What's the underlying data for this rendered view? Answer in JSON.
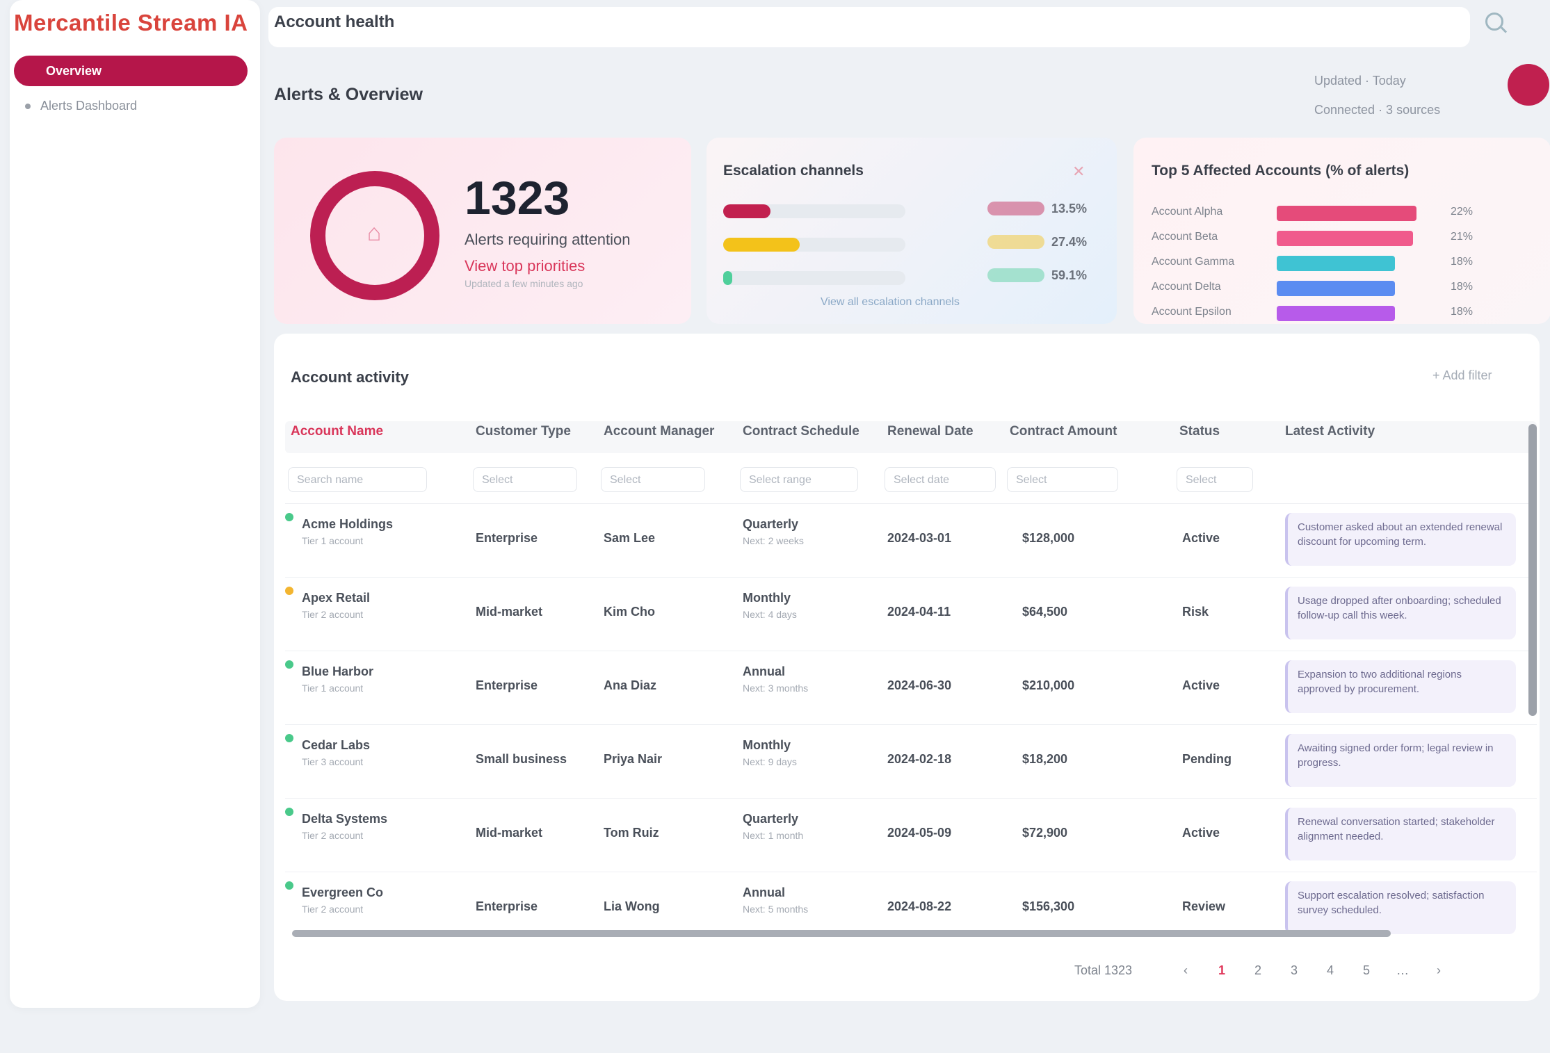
{
  "sidebar": {
    "brand": "Mercantile Stream IA",
    "active_item": "Overview",
    "items": [
      "Alerts Dashboard"
    ]
  },
  "topbar": {
    "breadcrumb": "Account health"
  },
  "header": {
    "title": "Alerts & Overview",
    "meta_line1": "Updated · Today",
    "meta_line2": "Connected · 3 sources"
  },
  "card1": {
    "total": "1323",
    "subtitle": "Alerts requiring attention",
    "link": "View top priorities",
    "note": "Updated a few minutes ago"
  },
  "card2": {
    "title": "Escalation channels",
    "rows": [
      {
        "pct": 0.26,
        "color": "#c2204f",
        "value": "13.5%"
      },
      {
        "pct": 0.42,
        "color": "#f3c21a",
        "value": "27.4%"
      },
      {
        "pct": 0.05,
        "color": "#4fcf9b",
        "value": "59.1%"
      }
    ],
    "footer": "View all escalation channels"
  },
  "card3": {
    "title": "Top 5 Affected Accounts (% of alerts)",
    "rows": [
      {
        "label": "Account Alpha",
        "pct": 0.92,
        "color": "#e54b7a",
        "value": "22%"
      },
      {
        "label": "Account Beta",
        "pct": 0.9,
        "color": "#f05a8c",
        "value": "21%"
      },
      {
        "label": "Account Gamma",
        "pct": 0.78,
        "color": "#3fc3d3",
        "value": "18%"
      },
      {
        "label": "Account Delta",
        "pct": 0.78,
        "color": "#5b8cf1",
        "value": "18%"
      },
      {
        "label": "Account Epsilon",
        "pct": 0.78,
        "color": "#b75bea",
        "value": "18%"
      }
    ]
  },
  "table": {
    "title": "Account activity",
    "action": "+ Add filter",
    "columns": [
      "Account Name",
      "Customer Type",
      "Account Manager",
      "Contract Schedule",
      "Renewal Date",
      "Contract Amount",
      "Status",
      "Latest Activity"
    ],
    "filters": [
      "Search name",
      "Select",
      "Select",
      "Select range",
      "Select date",
      "Select",
      "Select",
      ""
    ],
    "rows": [
      {
        "prio": "#49c98a",
        "name": "Acme Holdings",
        "name_sub": "Tier 1 account",
        "type": "Enterprise",
        "manager": "Sam Lee",
        "schedule": "Quarterly",
        "schedule_sub": "Next: 2 weeks",
        "renewal": "2024-03-01",
        "amount": "$128,000",
        "status": "Active",
        "note": "Customer asked about an extended renewal discount for upcoming term."
      },
      {
        "prio": "#f3b530",
        "name": "Apex Retail",
        "name_sub": "Tier 2 account",
        "type": "Mid-market",
        "manager": "Kim Cho",
        "schedule": "Monthly",
        "schedule_sub": "Next: 4 days",
        "renewal": "2024-04-11",
        "amount": "$64,500",
        "status": "Risk",
        "note": "Usage dropped after onboarding; scheduled follow-up call this week."
      },
      {
        "prio": "#49c98a",
        "name": "Blue Harbor",
        "name_sub": "Tier 1 account",
        "type": "Enterprise",
        "manager": "Ana Diaz",
        "schedule": "Annual",
        "schedule_sub": "Next: 3 months",
        "renewal": "2024-06-30",
        "amount": "$210,000",
        "status": "Active",
        "note": "Expansion to two additional regions approved by procurement."
      },
      {
        "prio": "#49c98a",
        "name": "Cedar Labs",
        "name_sub": "Tier 3 account",
        "type": "Small business",
        "manager": "Priya Nair",
        "schedule": "Monthly",
        "schedule_sub": "Next: 9 days",
        "renewal": "2024-02-18",
        "amount": "$18,200",
        "status": "Pending",
        "note": "Awaiting signed order form; legal review in progress."
      },
      {
        "prio": "#49c98a",
        "name": "Delta Systems",
        "name_sub": "Tier 2 account",
        "type": "Mid-market",
        "manager": "Tom Ruiz",
        "schedule": "Quarterly",
        "schedule_sub": "Next: 1 month",
        "renewal": "2024-05-09",
        "amount": "$72,900",
        "status": "Active",
        "note": "Renewal conversation started; stakeholder alignment needed."
      },
      {
        "prio": "#49c98a",
        "name": "Evergreen Co",
        "name_sub": "Tier 2 account",
        "type": "Enterprise",
        "manager": "Lia Wong",
        "schedule": "Annual",
        "schedule_sub": "Next: 5 months",
        "renewal": "2024-08-22",
        "amount": "$156,300",
        "status": "Review",
        "note": "Support escalation resolved; satisfaction survey scheduled."
      }
    ]
  },
  "pager": {
    "summary": "Total 1323",
    "pages": [
      "‹",
      "1",
      "2",
      "3",
      "4",
      "5",
      "…",
      "›"
    ]
  }
}
